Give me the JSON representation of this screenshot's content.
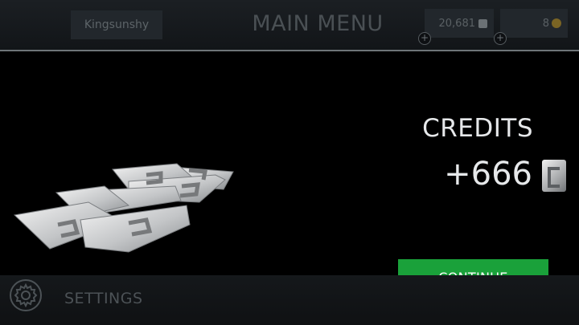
{
  "header": {
    "player_name": "Kingsunshy",
    "title": "MAIN MENU",
    "credits_balance": "20,681",
    "gold_balance": "8",
    "credits_icon": "credit-chip-icon",
    "gold_icon": "gold-coin-icon",
    "add_icon": "plus-icon"
  },
  "reward": {
    "title": "CREDITS",
    "amount": "+666",
    "icon": "credit-chip-icon",
    "illustration": "credit-chips-pile"
  },
  "actions": {
    "continue_label": "CONTINUE"
  },
  "footer": {
    "settings_label": "SETTINGS",
    "settings_icon": "gear-icon"
  },
  "colors": {
    "accent_green": "#1aa13a",
    "popup_background": "#000000",
    "popup_border": "#6e7478",
    "text_light": "#e6e8ea"
  }
}
